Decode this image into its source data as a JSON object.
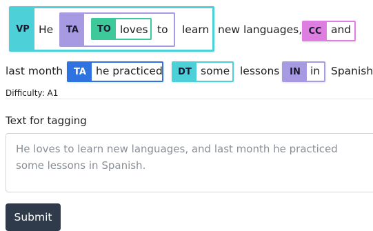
{
  "sentence": {
    "line1": {
      "w_he": "He",
      "w_loves": "loves",
      "w_to": "to",
      "w_learn": "learn",
      "w_new_languages": "new languages,",
      "w_and": "and"
    },
    "line2": {
      "w_last_month": "last month",
      "w_he_practiced": "he practiced",
      "w_some": "some",
      "w_lessons": "lessons",
      "w_in": "in",
      "w_spanish": "Spanish."
    }
  },
  "tags": {
    "vp": "VP",
    "ta_outer": "TA",
    "to": "TO",
    "cc": "CC",
    "ta_inner": "TA",
    "dt": "DT",
    "in": "IN"
  },
  "tag_colors": {
    "vp": "#4dd0d8",
    "ta": "#a89ae2",
    "to": "#3ec99b",
    "cc": "#de7ee0",
    "ta_blue": "#2f73e0",
    "dt": "#4dd0d8",
    "in": "#a89ae2"
  },
  "difficulty": "Difficulty: A1",
  "form": {
    "label": "Text for tagging",
    "text_value": "He loves to learn new languages, and last month he practiced some lessons in Spanish.",
    "submit_label": "Submit"
  }
}
